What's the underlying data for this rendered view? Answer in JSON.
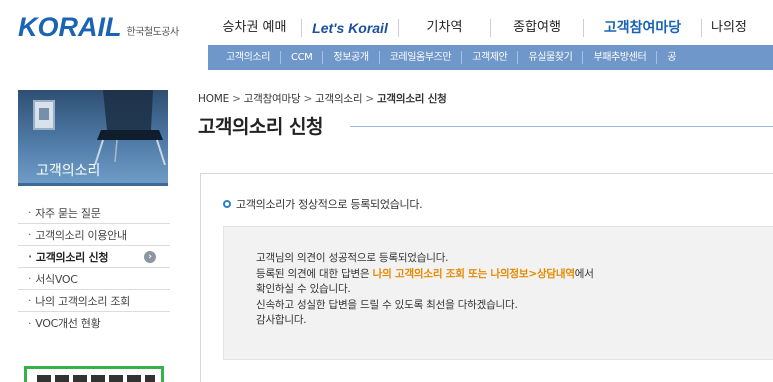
{
  "header": {
    "logo_text": "KORAIL",
    "logo_subtitle": "한국철도공사",
    "main_nav": [
      "승차권 예매",
      "Let's Korail",
      "기차역",
      "종합여행",
      "고객참여마당",
      "나의정"
    ],
    "sub_nav": [
      "고객의소리",
      "CCM",
      "정보공개",
      "코레일옴부즈만",
      "고객제안",
      "유실물찾기",
      "부패추방센터",
      "공"
    ]
  },
  "sidebar": {
    "banner_label": "고객의소리",
    "items": [
      {
        "label": "자주 묻는 질문"
      },
      {
        "label": "고객의소리 이용안내"
      },
      {
        "label": "고객의소리 신청"
      },
      {
        "label": "서식VOC"
      },
      {
        "label": "나의 고객의소리 조회"
      },
      {
        "label": "VOC개선 현황"
      }
    ],
    "active_arrow": "›"
  },
  "breadcrumb": {
    "items": [
      "HOME",
      "고객참여마당",
      "고객의소리",
      "고객의소리 신청"
    ],
    "separator": ">"
  },
  "page": {
    "title": "고객의소리 신청",
    "notice": "고객의소리가 정상적으로 등록되었습니다.",
    "message": {
      "line1": "고객님의 의견이 성공적으로 등록되었습니다.",
      "line2_before": "등록된 의견에 대한 답변은 ",
      "line2_highlight": "나의 고객의소리 조회 또는 나의정보>상담내역",
      "line2_after": "에서",
      "line3": "확인하실 수 있습니다.",
      "line4": "신속하고 성실한 답변을 드릴 수 있도록 최선을 다하겠습니다.",
      "line5": "감사합니다."
    }
  },
  "colors": {
    "brand_blue": "#1b64b4",
    "subnav_bg": "#6f97c9",
    "highlight_orange": "#e58a00"
  }
}
